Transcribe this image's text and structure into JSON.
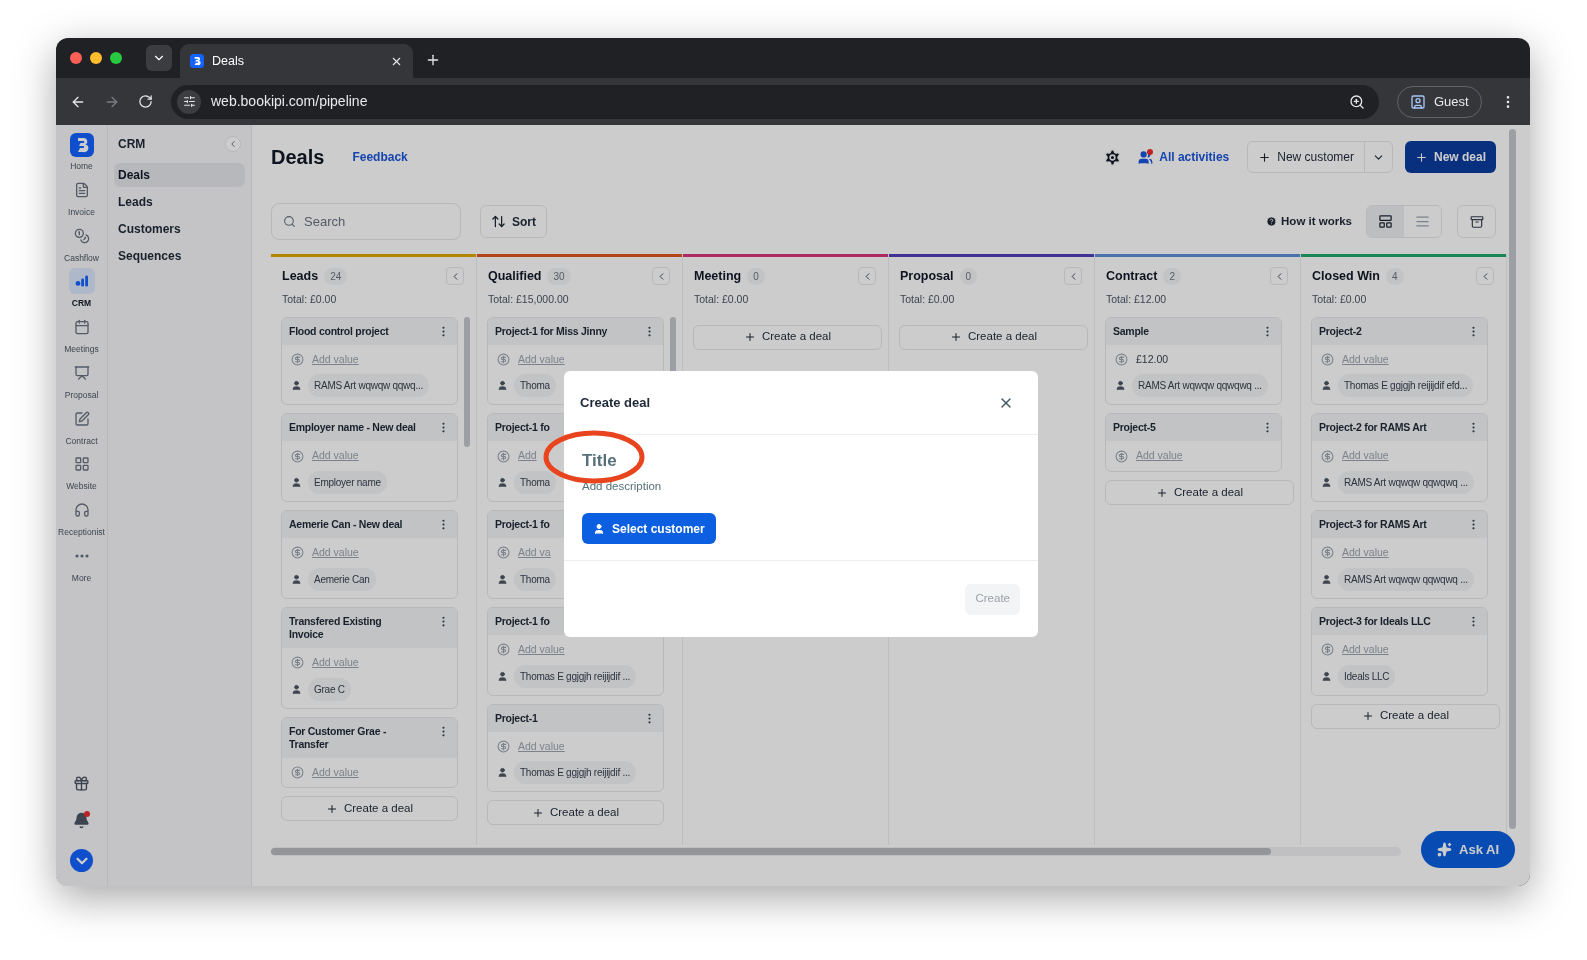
{
  "browser": {
    "tab_title": "Deals",
    "url": "web.bookipi.com/pipeline",
    "profile": "Guest"
  },
  "rail": {
    "items": [
      {
        "label": "Home",
        "selected": false
      },
      {
        "label": "Invoice",
        "selected": false
      },
      {
        "label": "Cashflow",
        "selected": false
      },
      {
        "label": "CRM",
        "selected": true
      },
      {
        "label": "Meetings",
        "selected": false
      },
      {
        "label": "Proposal",
        "selected": false
      },
      {
        "label": "Contract",
        "selected": false
      },
      {
        "label": "Website",
        "selected": false
      },
      {
        "label": "Receptionist",
        "selected": false
      },
      {
        "label": "More",
        "selected": false
      }
    ]
  },
  "crm_sidebar": {
    "title": "CRM",
    "items": [
      {
        "label": "Deals",
        "selected": true
      },
      {
        "label": "Leads",
        "selected": false
      },
      {
        "label": "Customers",
        "selected": false
      },
      {
        "label": "Sequences",
        "selected": false
      }
    ]
  },
  "header": {
    "title": "Deals",
    "feedback": "Feedback",
    "activities": "All activities",
    "new_customer": "New customer",
    "new_deal": "New deal"
  },
  "toolbar": {
    "search_placeholder": "Search",
    "sort": "Sort",
    "how_it_works": "How it works",
    "views": [
      {
        "kind": "board",
        "selected": true
      },
      {
        "kind": "list",
        "selected": false
      }
    ]
  },
  "columns": [
    {
      "name": "Leads",
      "count": "24",
      "total": "Total: £0.00",
      "color": "#b38600",
      "has_scrollbar": true,
      "create": "Create a deal",
      "cards": [
        {
          "title": "Flood control project",
          "value": "Add value",
          "value_is_link": true,
          "customer": "RAMS Art wqwqw qqwq..."
        },
        {
          "title": "Employer name - New deal",
          "value": "Add value",
          "value_is_link": true,
          "customer": "Employer name"
        },
        {
          "title": "Aemerie Can - New deal",
          "value": "Add value",
          "value_is_link": true,
          "customer": "Aemerie Can"
        },
        {
          "title": "Transfered Existing Invoice",
          "value": "Add value",
          "value_is_link": true,
          "customer": "Grae C"
        },
        {
          "title": "For Customer Grae - Transfer",
          "value": "Add value",
          "value_is_link": true
        }
      ]
    },
    {
      "name": "Qualified",
      "count": "30",
      "total": "Total: £15,000.00",
      "color": "#b54318",
      "has_scrollbar": true,
      "create": "Create a deal",
      "cards": [
        {
          "title": "Project-1 for Miss Jinny",
          "value": "Add value",
          "value_is_link": true,
          "customer": "Thoma"
        },
        {
          "title": "Project-1 fo",
          "value": "Add",
          "value_is_link": true,
          "customer": "Thoma",
          "covered": true
        },
        {
          "title": "Project-1 fo",
          "value": "Add va",
          "value_is_link": true,
          "customer": "Thoma",
          "covered": true
        },
        {
          "title": "Project-1 fo",
          "value": "Add value",
          "value_is_link": true,
          "customer": "Thomas E ggjgjh reijijdif ...",
          "covered": true
        },
        {
          "title": "Project-1",
          "value": "Add value",
          "value_is_link": true,
          "customer": "Thomas E ggjgjh reijijdif ..."
        }
      ]
    },
    {
      "name": "Meeting",
      "count": "0",
      "total": "Total: £0.00",
      "color": "#ad2962",
      "has_scrollbar": false,
      "create": "Create a deal"
    },
    {
      "name": "Proposal",
      "count": "0",
      "total": "Total: £0.00",
      "color": "#403393",
      "has_scrollbar": false,
      "create": "Create a deal"
    },
    {
      "name": "Contract",
      "count": "2",
      "total": "Total: £12.00",
      "color": "#4972ae",
      "has_scrollbar": false,
      "create": "Create a deal",
      "cards": [
        {
          "title": "Sample",
          "value": "£12.00",
          "value_is_link": false,
          "customer": "RAMS Art wqwqw qqwqwq ..."
        },
        {
          "title": "Project-5",
          "value": "Add value",
          "value_is_link": true
        }
      ]
    },
    {
      "name": "Closed Win",
      "count": "4",
      "total": "Total: £0.00",
      "color": "#198655",
      "has_scrollbar": false,
      "create": "Create a deal",
      "cards": [
        {
          "title": "Project-2",
          "value": "Add value",
          "value_is_link": true,
          "customer": "Thomas E ggjgjh reijijdif efd..."
        },
        {
          "title": "Project-2 for RAMS Art",
          "value": "Add value",
          "value_is_link": true,
          "customer": "RAMS Art wqwqw qqwqwq ..."
        },
        {
          "title": "Project-3 for RAMS Art",
          "value": "Add value",
          "value_is_link": true,
          "customer": "RAMS Art wqwqw qqwqwq ..."
        },
        {
          "title": "Project-3 for Ideals LLC",
          "value": "Add value",
          "value_is_link": true,
          "customer": "Ideals LLC"
        }
      ]
    }
  ],
  "dialog": {
    "title": "Create deal",
    "title_placeholder": "Title",
    "description_placeholder": "Add description",
    "select_customer": "Select customer",
    "create": "Create",
    "create_disabled": true
  },
  "ask_ai": "Ask AI"
}
